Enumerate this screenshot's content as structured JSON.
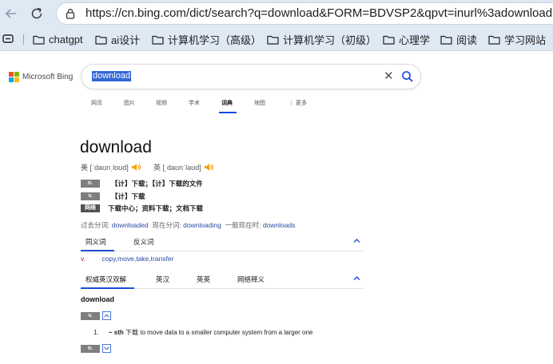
{
  "browser": {
    "url": "https://cn.bing.com/dict/search?q=download&FORM=BDVSP2&qpvt=inurl%3adownload",
    "bookmarks": [
      "chatgpt",
      "ai设计",
      "计算机学习（高级）",
      "计算机学习（初级）",
      "心理学",
      "阅读",
      "学习网站"
    ]
  },
  "bing": {
    "logo_text": "Microsoft Bing",
    "query": "download",
    "clear_symbol": "✕",
    "tabs": [
      "网页",
      "图片",
      "视频",
      "学术",
      "词典",
      "地图",
      "⋮ 更多"
    ],
    "active_tab": "词典"
  },
  "entry": {
    "headword": "download",
    "phonetic_us": "美 [ˈdaʊnˌloʊd]",
    "phonetic_uk": "英 [ˌdaʊnˈləʊd]",
    "definitions": [
      {
        "pos": "n.",
        "text": "【计】下载；【计】下载的文件"
      },
      {
        "pos": "v.",
        "text": "【计】下载"
      },
      {
        "pos": "网络",
        "text": "下载中心；资料下载；文档下载"
      }
    ],
    "forms": {
      "past_participle_label": "过去分词:",
      "past_participle": "downloaded",
      "present_participle_label": "现在分词:",
      "present_participle": "downloading",
      "present_label": "一般现在时:",
      "present": "downloads"
    },
    "syn_tabs": [
      "同义词",
      "反义词"
    ],
    "synonyms_pos": "v.",
    "synonyms": "copy,move,take,transfer",
    "dict_tabs": [
      "权威英汉双解",
      "英汉",
      "英英",
      "网络释义"
    ],
    "sub_headword": "download",
    "pos_v": "v.",
    "pos_n": "n.",
    "sense_num": "1.",
    "sense_pattern": "~ sth",
    "sense_cn": "下载",
    "sense_en": "to move data to a smaller computer system from a larger one"
  }
}
